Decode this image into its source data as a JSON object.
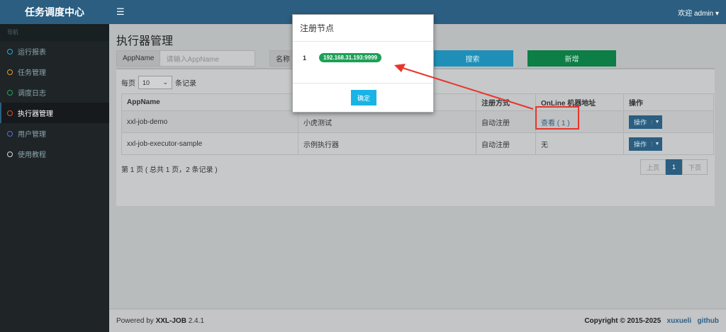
{
  "sidebar": {
    "brand": "任务调度中心",
    "nav_header": "导航",
    "items": [
      {
        "label": "运行报表",
        "color": "#2aa8d8"
      },
      {
        "label": "任务管理",
        "color": "#e8952e"
      },
      {
        "label": "调度日志",
        "color": "#22a55a"
      },
      {
        "label": "执行器管理",
        "color": "#e8492e"
      },
      {
        "label": "用户管理",
        "color": "#5a6bd8"
      },
      {
        "label": "使用教程",
        "color": "#d8d8d8"
      }
    ]
  },
  "topbar": {
    "menu_icon": "hamburger-icon",
    "welcome": "欢迎 admin",
    "caret": "▾"
  },
  "main": {
    "title": "执行器管理",
    "filter_appname_label": "AppName",
    "filter_appname_placeholder": "请输入AppName",
    "filter_name_label": "名称",
    "search_label": "搜索",
    "add_label": "新增",
    "per_page_prefix": "每页",
    "per_page_value": "10",
    "per_page_suffix": "条记录",
    "table": {
      "headers": [
        "AppName",
        "",
        "注册方式",
        "OnLine 机器地址",
        "操作"
      ],
      "rows": [
        {
          "appname": "xxl-job-demo",
          "name": "小虎测试",
          "type": "自动注册",
          "online": "查看 ( 1 )",
          "op": "操作"
        },
        {
          "appname": "xxl-job-executor-sample",
          "name": "示例执行器",
          "type": "自动注册",
          "online": "无",
          "op": "操作"
        }
      ]
    },
    "page_info": "第 1 页 ( 总共 1 页，2 条记录 )",
    "pager": {
      "prev": "上页",
      "current": "1",
      "next": "下页"
    }
  },
  "footer": {
    "powered_prefix": "Powered by",
    "powered_name": "XXL-JOB",
    "version": "2.4.1",
    "copyright": "Copyright © 2015-2025",
    "author": "xuxueli",
    "github": "github"
  },
  "modal": {
    "title": "注册节点",
    "index": "1",
    "address": "192.168.31.193:9999",
    "ok_label": "确定"
  },
  "annotation_color": "#e8352b"
}
